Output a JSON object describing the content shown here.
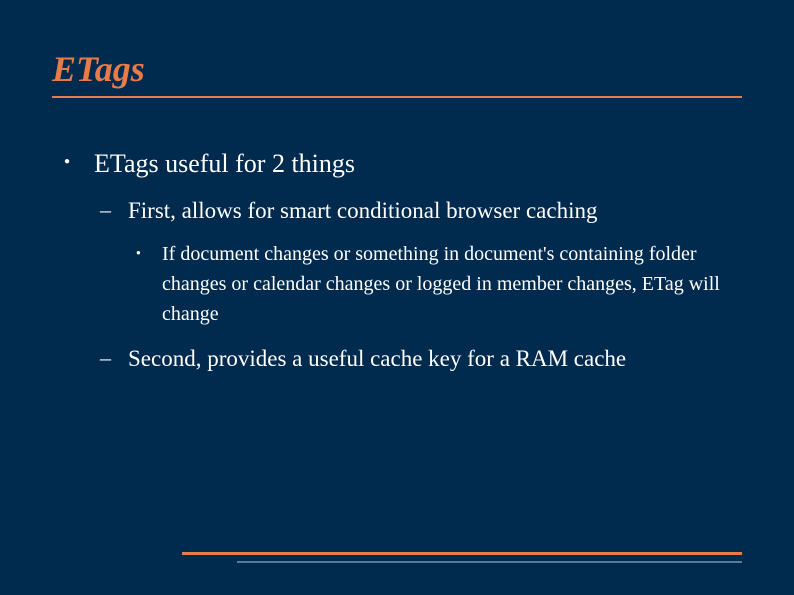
{
  "title": "ETags",
  "bullets": {
    "main": "ETags useful for 2 things",
    "sub1": "First, allows for smart conditional browser caching",
    "sub1_detail": "If document changes or something in document's containing folder changes or calendar changes or logged in member changes, ETag will change",
    "sub2": "Second, provides a useful cache key for a RAM cache"
  }
}
